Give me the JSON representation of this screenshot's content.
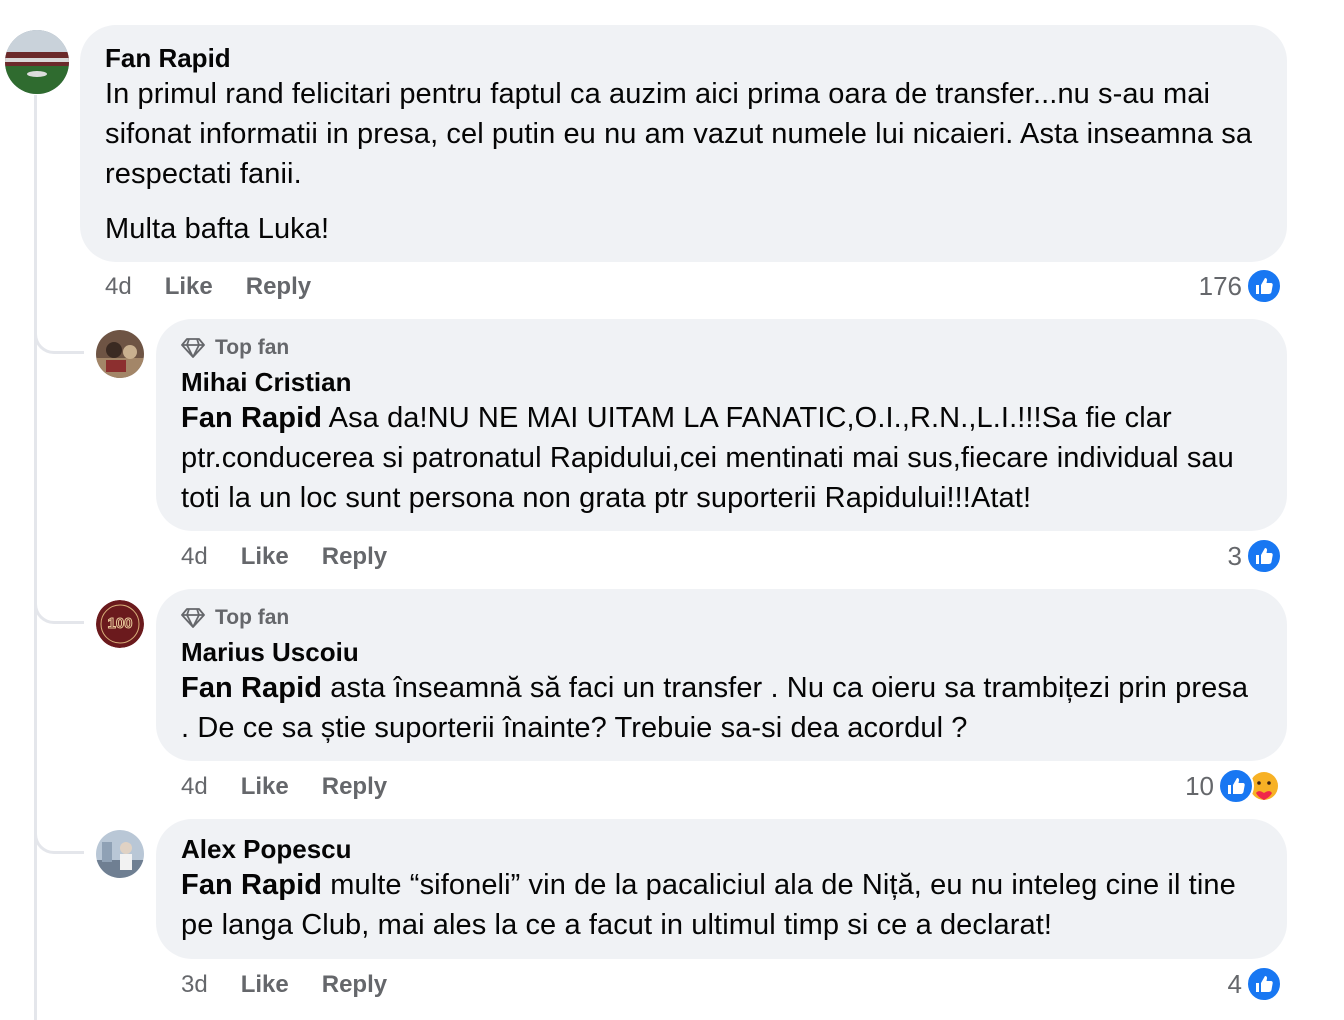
{
  "comments": [
    {
      "author": "Fan Rapid",
      "text_p1": "In primul rand felicitari pentru faptul ca auzim aici prima oara de transfer...nu s-au mai sifonat informatii in presa, cel putin eu nu am vazut numele lui nicaieri. Asta inseamna sa respectati fanii.",
      "text_p2": "Multa bafta Luka!",
      "time": "4d",
      "like_label": "Like",
      "reply_label": "Reply",
      "reaction_count": "176"
    }
  ],
  "replies": [
    {
      "badge": "Top fan",
      "author": "Mihai Cristian",
      "mention": "Fan Rapid",
      "text": " Asa da!NU NE MAI UITAM LA FANATIC,O.I.,R.N.,L.I.!!!Sa fie clar ptr.conducerea si patronatul Rapidului,cei mentinati mai sus,fiecare individual sau toti la un loc sunt persona non grata ptr suporterii Rapidului!!!Atat!",
      "time": "4d",
      "like_label": "Like",
      "reply_label": "Reply",
      "reaction_count": "3"
    },
    {
      "badge": "Top fan",
      "author": "Marius Uscoiu",
      "mention": "Fan Rapid",
      "text": " asta înseamnă să faci un transfer . Nu ca oieru sa trambițezi prin presa . De ce sa știe suporterii înainte? Trebuie sa-si dea acordul ?",
      "time": "4d",
      "like_label": "Like",
      "reply_label": "Reply",
      "reaction_count": "10",
      "avatar_text": "100"
    },
    {
      "author": "Alex Popescu",
      "mention": "Fan Rapid",
      "text": " multe “sifoneli” vin de la pacaliciul ala de Niță, eu nu inteleg cine il tine pe langa Club, mai ales la ce a facut in ultimul timp si ce a declarat!",
      "time": "3d",
      "like_label": "Like",
      "reply_label": "Reply",
      "reaction_count": "4"
    }
  ],
  "icons": {
    "like": "like-thumb-icon",
    "care": "care-reaction-icon",
    "top_fan": "diamond-icon"
  },
  "colors": {
    "like_blue": "#1877f2",
    "bubble_bg": "#f0f2f5",
    "muted_text": "#65676b"
  }
}
